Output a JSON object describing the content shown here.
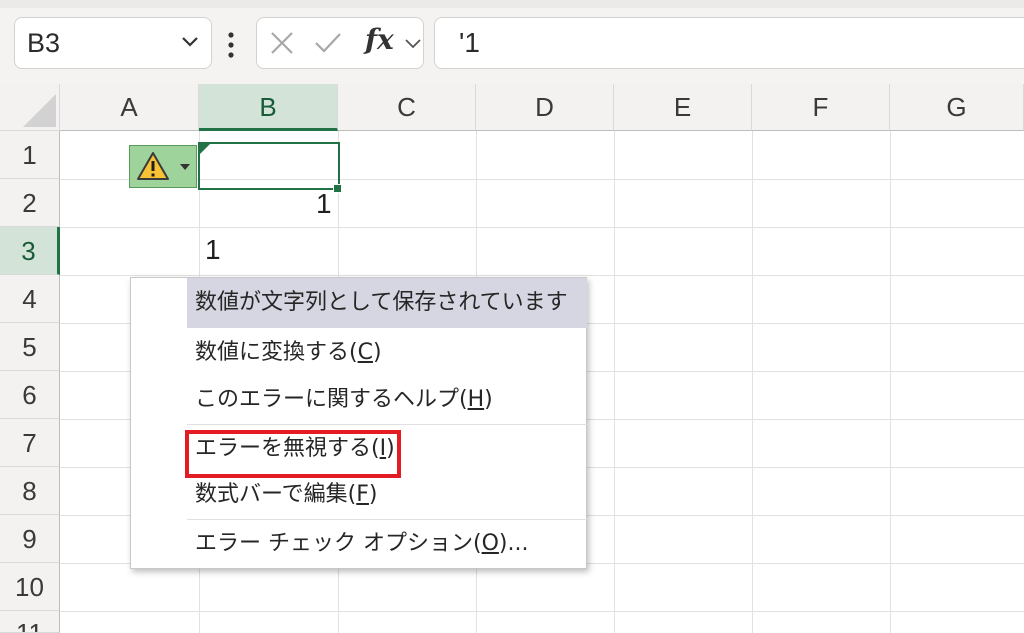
{
  "name_box": {
    "value": "B3"
  },
  "formula_bar": {
    "fx_label": "fx",
    "content": "'1"
  },
  "columns": [
    "A",
    "B",
    "C",
    "D",
    "E",
    "F",
    "G"
  ],
  "rows": [
    "1",
    "2",
    "3",
    "4",
    "5",
    "6",
    "7",
    "8",
    "9",
    "10",
    "11"
  ],
  "cells": {
    "B2": "1",
    "B3": "1"
  },
  "selected": {
    "column": "B",
    "row": "3"
  },
  "error_button": {
    "icon": "warning-icon"
  },
  "context_menu": {
    "header": "数値が文字列として保存されています",
    "items": [
      {
        "text": "数値に変換する(",
        "key": "C",
        "suffix": ")"
      },
      {
        "text": "このエラーに関するヘルプ(",
        "key": "H",
        "suffix": ")"
      },
      {
        "text": "エラーを無視する(",
        "key": "I",
        "suffix": ")"
      },
      {
        "text": "数式バーで編集(",
        "key": "F",
        "suffix": ")"
      },
      {
        "text": "エラー チェック オプション(",
        "key": "O",
        "suffix": ")..."
      }
    ]
  },
  "colors": {
    "accent": "#217346",
    "highlight_box": "#e31b23",
    "menu_header_bg": "#d6d6e2"
  }
}
